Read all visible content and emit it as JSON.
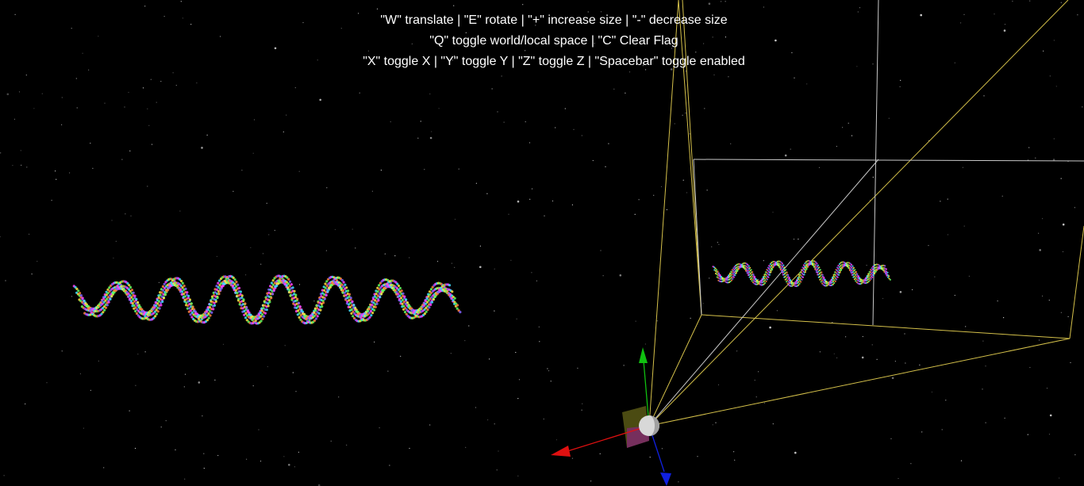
{
  "instructions": {
    "line1": "\"W\" translate | \"E\" rotate | \"+\" increase size | \"-\" decrease size",
    "line2": "\"Q\" toggle world/local space | \"C\" Clear Flag",
    "line3": "\"X\" toggle X | \"Y\" toggle Y | \"Z\" toggle Z | \"Spacebar\" toggle enabled"
  },
  "scene": {
    "background": "#000000",
    "frustum_color": "#d4c04a",
    "frustum_inner_color": "#c9c9c9",
    "gizmo_axes": {
      "x_color": "#e01010",
      "y_color": "#10c010",
      "z_color": "#1020e0"
    },
    "wave_colors": [
      "#ff40ff",
      "#40e0ff",
      "#ffe040",
      "#60ff60",
      "#ff8040",
      "#8060ff"
    ]
  }
}
